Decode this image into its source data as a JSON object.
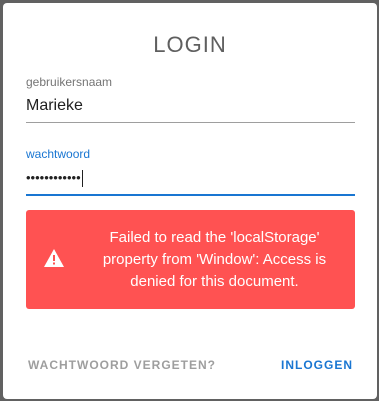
{
  "dialog": {
    "title": "LOGIN"
  },
  "username": {
    "label": "gebruikersnaam",
    "value": "Marieke"
  },
  "password": {
    "label": "wachtwoord",
    "masked_value": "••••••••••••"
  },
  "alert": {
    "icon": "warning-icon",
    "message": "Failed to read the 'localStorage' property from 'Window': Access is denied for this document.",
    "color": "#ff5252"
  },
  "actions": {
    "forgot_label": "WACHTWOORD VERGETEN?",
    "login_label": "INLOGGEN",
    "accent_color": "#1976d2"
  }
}
